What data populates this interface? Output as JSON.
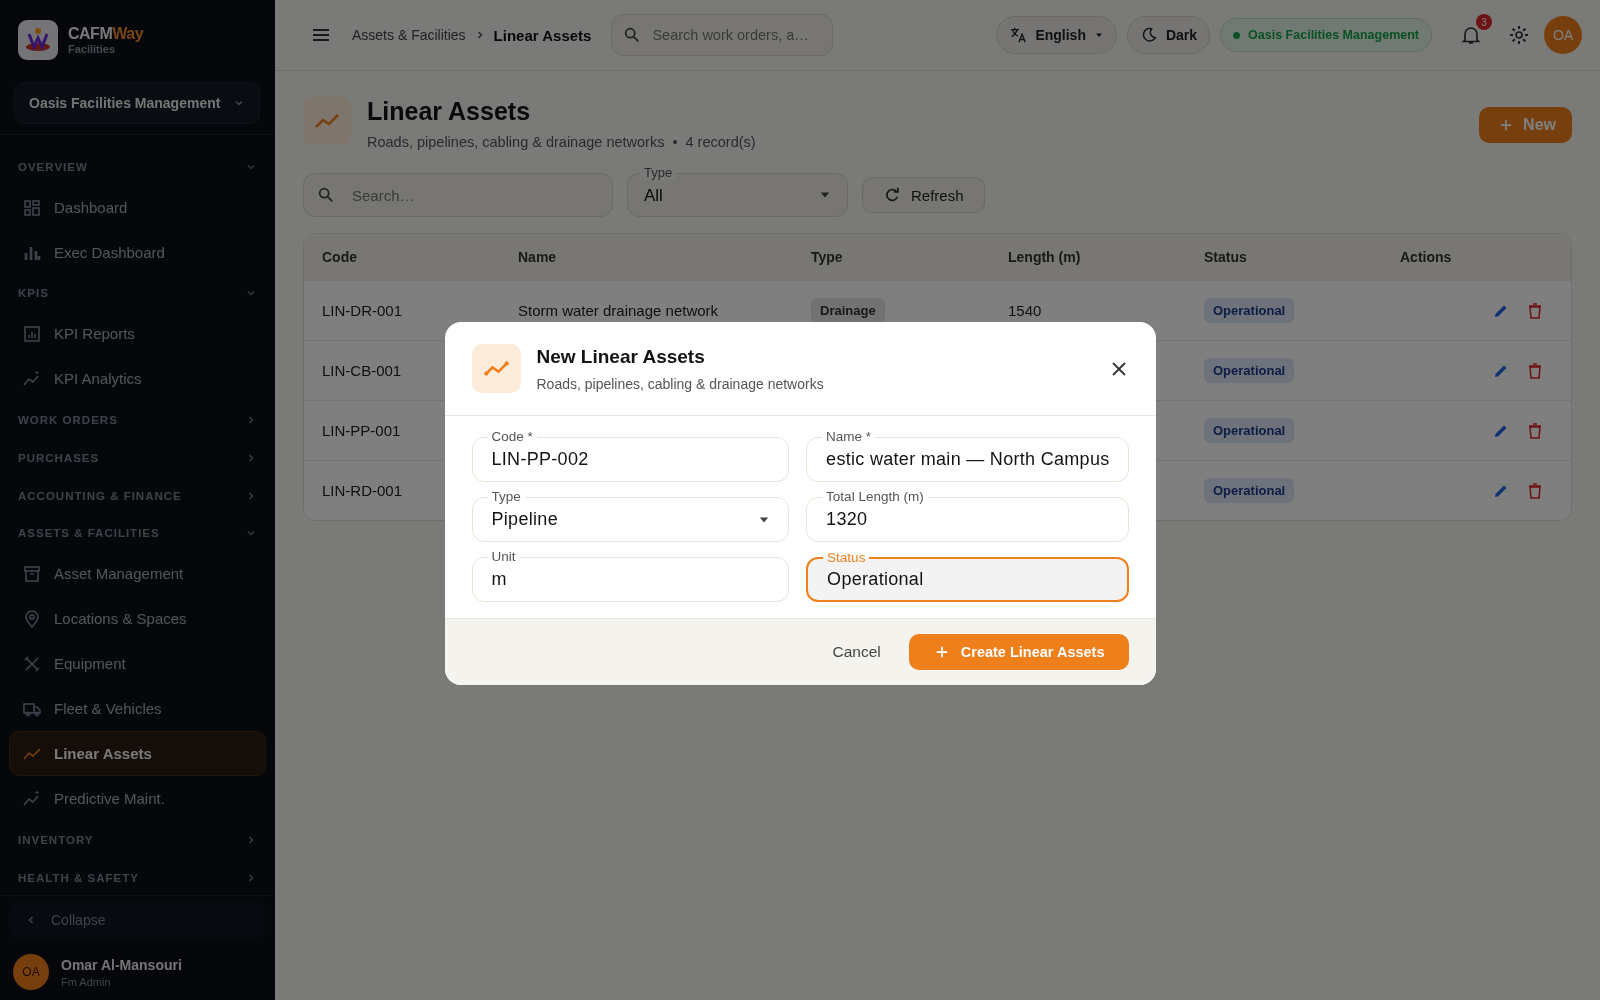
{
  "sidebar": {
    "brand": {
      "name_main": "CAFM",
      "name_accent": "Way",
      "subtitle": "Facilities"
    },
    "org_selector": {
      "value": "Oasis Facilities Management"
    },
    "sections": [
      {
        "label": "OVERVIEW",
        "expanded": true,
        "items": [
          {
            "label": "Dashboard",
            "selected": false
          },
          {
            "label": "Exec Dashboard",
            "selected": false
          }
        ]
      },
      {
        "label": "KPIS",
        "expanded": true,
        "items": [
          {
            "label": "KPI Reports",
            "selected": false
          },
          {
            "label": "KPI Analytics",
            "selected": false
          }
        ]
      },
      {
        "label": "WORK ORDERS",
        "expanded": false
      },
      {
        "label": "PURCHASES",
        "expanded": false
      },
      {
        "label": "ACCOUNTING & FINANCE",
        "expanded": false
      },
      {
        "label": "ASSETS & FACILITIES",
        "expanded": true,
        "items": [
          {
            "label": "Asset Management",
            "selected": false
          },
          {
            "label": "Locations & Spaces",
            "selected": false
          },
          {
            "label": "Equipment",
            "selected": false
          },
          {
            "label": "Fleet & Vehicles",
            "selected": false
          },
          {
            "label": "Linear Assets",
            "selected": true
          },
          {
            "label": "Predictive Maint.",
            "selected": false
          }
        ]
      },
      {
        "label": "INVENTORY",
        "expanded": false
      },
      {
        "label": "HEALTH & SAFETY",
        "expanded": false
      }
    ],
    "collapse": {
      "label": "Collapse"
    },
    "user": {
      "initials": "OA",
      "name": "Omar Al-Mansouri",
      "role": "Fm Admin"
    }
  },
  "header": {
    "breadcrumb": [
      "Assets & Facilities",
      "Linear Assets"
    ],
    "search": {
      "placeholder": "Search work orders, a…"
    },
    "language": "English",
    "theme": "Dark",
    "org_badge": {
      "label": "Oasis Facilities Management"
    },
    "notifications": "3",
    "avatar": "OA"
  },
  "page": {
    "title": "Linear Assets",
    "subtitle": "Roads, pipelines, cabling & drainage networks",
    "separator": "•",
    "record_count": "4 record(s)",
    "new_button": "New",
    "filters": {
      "search": {
        "placeholder": "Search…"
      },
      "type": {
        "label": "Type",
        "value": "All"
      },
      "refresh": "Refresh"
    },
    "table": {
      "columns": [
        "Code",
        "Name",
        "Type",
        "Length (m)",
        "Status",
        "Actions"
      ],
      "rows": [
        {
          "code": "LIN-DR-001",
          "name": "Storm water drainage network",
          "type": "Drainage",
          "length": "1540",
          "status": "Operational"
        },
        {
          "code": "LIN-CB-001",
          "status": "Operational"
        },
        {
          "code": "LIN-PP-001",
          "status": "Operational"
        },
        {
          "code": "LIN-RD-001",
          "status": "Operational"
        }
      ]
    }
  },
  "dialog": {
    "title": "New Linear Assets",
    "subtitle": "Roads, pipelines, cabling & drainage networks",
    "fields": [
      {
        "kind": "text",
        "label": "Code *",
        "value": "LIN-PP-002",
        "focused": false
      },
      {
        "kind": "text",
        "label": "Name *",
        "value": "estic water main — North Campus",
        "focused": false
      },
      {
        "kind": "select",
        "label": "Type",
        "value": "Pipeline",
        "focused": false
      },
      {
        "kind": "text",
        "label": "Total Length (m)",
        "value": "1320",
        "focused": false
      },
      {
        "kind": "text",
        "label": "Unit",
        "value": "m",
        "focused": false
      },
      {
        "kind": "text",
        "label": "Status",
        "value": "Operational",
        "focused": true
      }
    ],
    "cancel": "Cancel",
    "submit": "Create Linear Assets"
  }
}
